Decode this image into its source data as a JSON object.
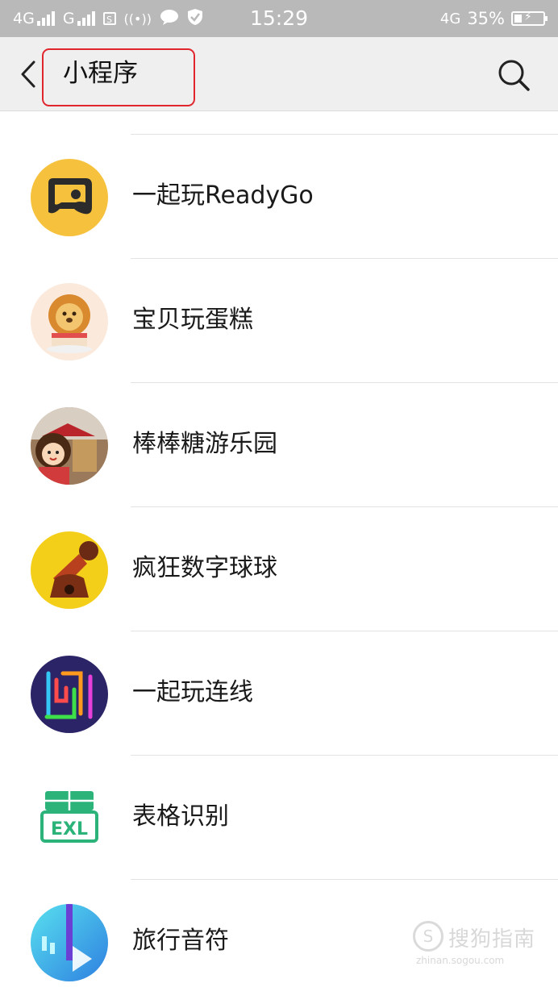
{
  "status_bar": {
    "network1": "4G",
    "network2": "G",
    "sim_badge": "S",
    "time": "15:29",
    "network_right": "4G",
    "battery": "35%"
  },
  "header": {
    "title": "小程序"
  },
  "list": [
    {
      "name": "一起玩ReadyGo",
      "icon": "gamepad-icon"
    },
    {
      "name": "宝贝玩蛋糕",
      "icon": "lion-cake-icon"
    },
    {
      "name": "棒棒糖游乐园",
      "icon": "carousel-girl-icon"
    },
    {
      "name": "疯狂数字球球",
      "icon": "cannon-icon"
    },
    {
      "name": "一起玩连线",
      "icon": "connect-lines-icon"
    },
    {
      "name": "表格识别",
      "icon": "exl-table-icon"
    },
    {
      "name": "旅行音符",
      "icon": "music-travel-icon"
    }
  ],
  "watermark": {
    "text": "搜狗指南",
    "sub": "zhinan.sogou.com"
  },
  "colors": {
    "status_bar": "#b9b9b9",
    "header_bg": "#efefef",
    "highlight_box": "#e0262c"
  }
}
